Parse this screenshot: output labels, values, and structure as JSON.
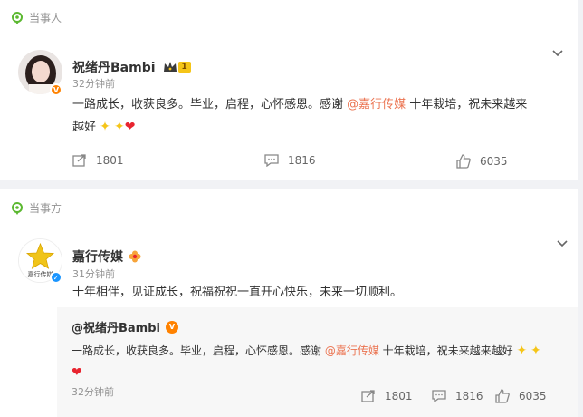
{
  "post1": {
    "tag": "当事人",
    "name": "祝绪丹Bambi",
    "level": "1",
    "time": "32分钟前",
    "text_a": "一路成长，收获良多。毕业，启程，心怀感恩。感谢 ",
    "mention": "@嘉行传媒",
    "text_b": " 十年栽培，祝未来越来",
    "text_c": "越好 ",
    "reposts": "1801",
    "comments": "1816",
    "likes": "6035"
  },
  "post2": {
    "tag": "当事方",
    "name": "嘉行传媒",
    "avatar_text": "嘉行传媒",
    "time": "31分钟前",
    "text": "十年相伴，见证成长，祝福祝祝一直开心快乐，未来一切顺利。",
    "quoted": {
      "name": "@祝绪丹Bambi",
      "text_a": "一路成长，收获良多。毕业，启程，心怀感恩。感谢 ",
      "mention": "@嘉行传媒",
      "text_b": " 十年栽培，祝未来越来越好 ",
      "time": "32分钟前",
      "reposts": "1801",
      "comments": "1816",
      "likes": "6035"
    }
  },
  "icons": {
    "repost": "share-icon",
    "comment": "comment-icon",
    "like": "thumbs-up-icon",
    "more": "chevron-down-icon",
    "tag": "location-pin-icon"
  },
  "colors": {
    "mention": "#eb7350",
    "tag_green": "#5bb830",
    "verified_orange": "#ff8200",
    "verified_blue": "#1a95ff",
    "heart": "#e8242f"
  }
}
